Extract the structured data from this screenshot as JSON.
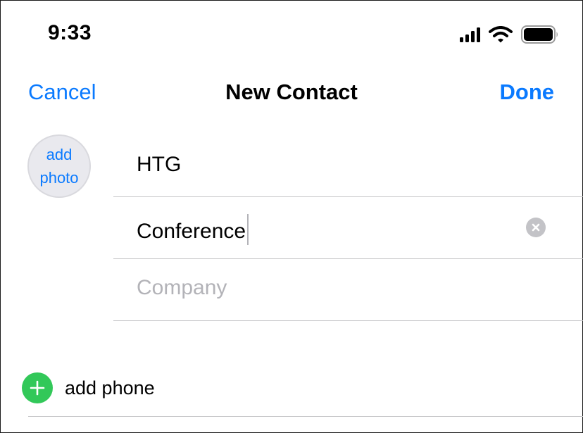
{
  "status_bar": {
    "time": "9:33"
  },
  "nav": {
    "cancel_label": "Cancel",
    "title": "New Contact",
    "done_label": "Done"
  },
  "photo": {
    "line1": "add",
    "line2": "photo"
  },
  "fields": {
    "first_name": "HTG",
    "last_name": "Conference",
    "company_placeholder": "Company"
  },
  "add_phone_label": "add phone",
  "colors": {
    "accent": "#0a7aff",
    "add_green": "#32c859",
    "separator": "#c6c6c8",
    "placeholder": "#b3b3b8"
  },
  "icons": {
    "clear": "clear-icon",
    "add": "plus-icon",
    "signal": "signal-icon",
    "wifi": "wifi-icon",
    "battery": "battery-icon"
  }
}
